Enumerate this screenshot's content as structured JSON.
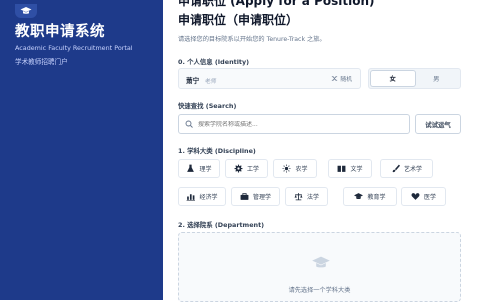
{
  "sidebar": {
    "title": "教职申请系统",
    "subtitle_en": "Academic Faculty Recruitment Portal",
    "subtitle_cn": "学术教师招聘门户",
    "logo_icon": "graduation-cap-icon"
  },
  "header": {
    "title_line1": "申请职位 (Apply for a Position)",
    "title_line2": "申请职位（申请职位）",
    "instruction": "请选择您的目标院系以开始您的 Tenure-Track 之旅。"
  },
  "identity": {
    "label": "0. 个人信息 (Identity)",
    "name": "萧宁",
    "role": "老师",
    "random_label": "随机",
    "gender_options": [
      "女",
      "男"
    ],
    "gender_selected": "女"
  },
  "search": {
    "label": "快速查找 (Search)",
    "placeholder": "搜索学院名称或描述...",
    "luck_button": "试试运气"
  },
  "discipline": {
    "label": "1. 学科大类 (Discipline)",
    "items": [
      {
        "label": "理学",
        "icon": "flask-icon"
      },
      {
        "label": "工学",
        "icon": "gear-icon"
      },
      {
        "label": "农学",
        "icon": "sun-icon"
      },
      {
        "label": "文学",
        "icon": "book-icon"
      },
      {
        "label": "艺术学",
        "icon": "brush-icon"
      },
      {
        "label": "经济学",
        "icon": "bar-chart-icon"
      },
      {
        "label": "管理学",
        "icon": "briefcase-icon"
      },
      {
        "label": "法学",
        "icon": "scales-icon"
      },
      {
        "label": "教育学",
        "icon": "graduation-cap-icon"
      },
      {
        "label": "医学",
        "icon": "heart-icon"
      }
    ]
  },
  "department": {
    "label": "2. 选择院系 (Department)",
    "empty_text": "请先选择一个学科大类"
  },
  "colors": {
    "sidebar_bg": "#1e3a8a",
    "accent": "#1e293b"
  }
}
